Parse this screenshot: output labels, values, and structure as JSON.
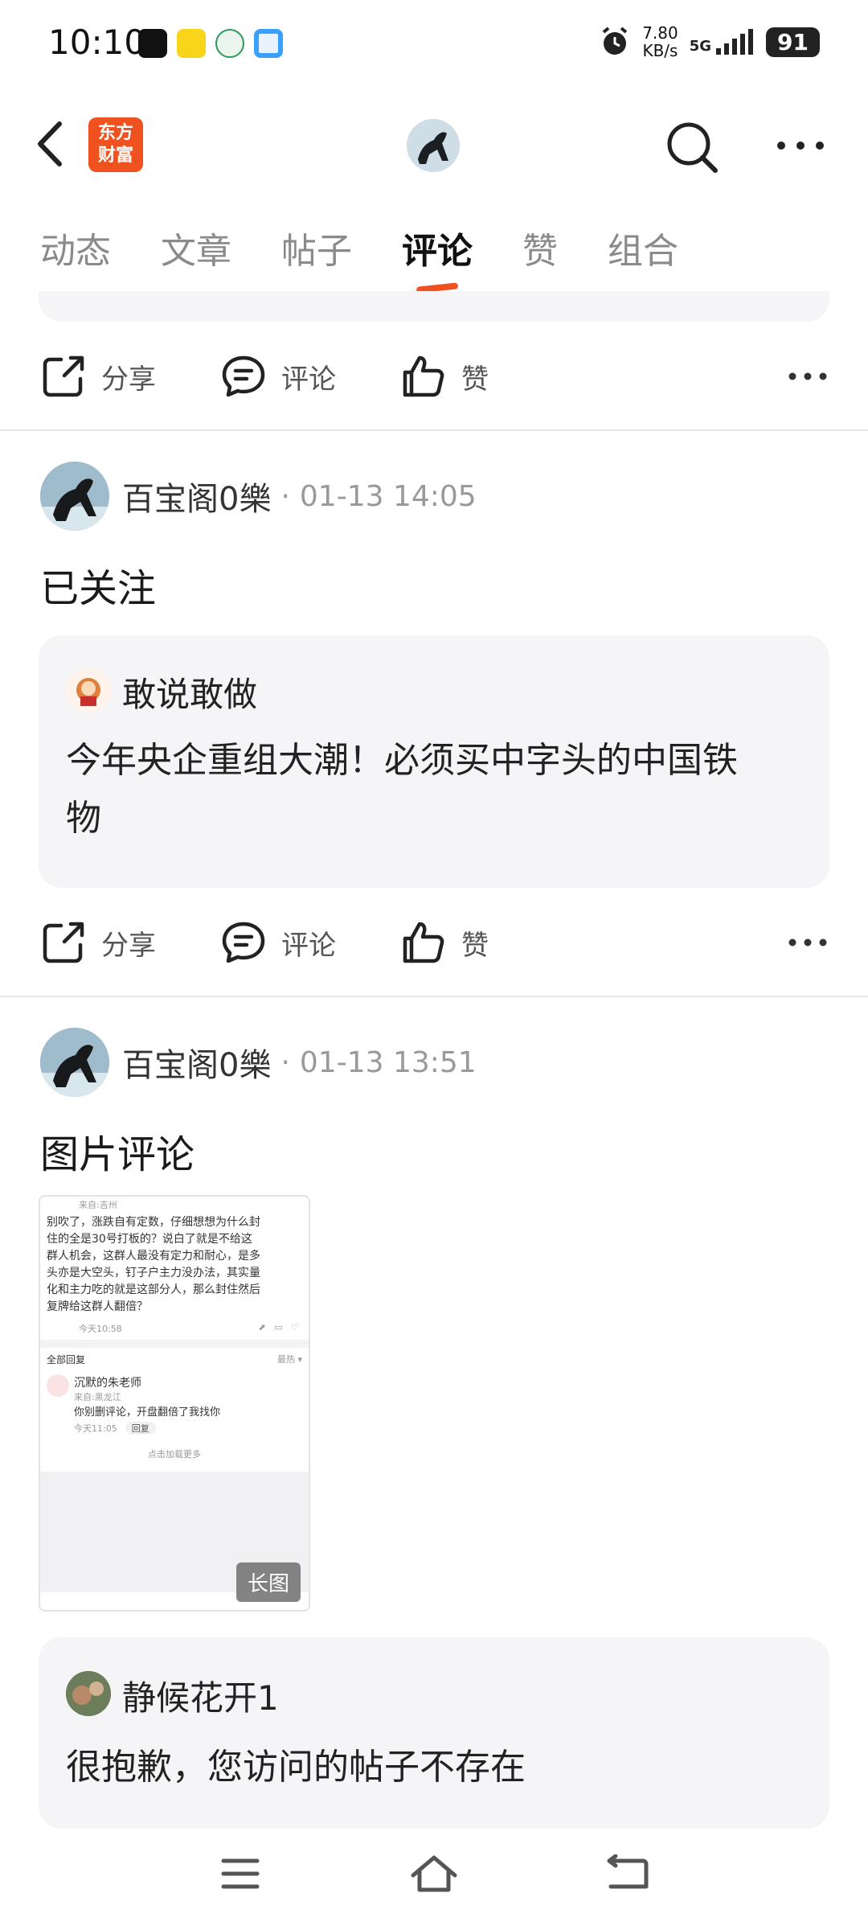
{
  "status": {
    "time": "10:10",
    "speed_value": "7.80",
    "speed_unit": "KB/s",
    "network": "5G",
    "battery": "91"
  },
  "header": {
    "logo_line1": "东方",
    "logo_line2": "财富"
  },
  "tabs": [
    {
      "label": "动态"
    },
    {
      "label": "文章"
    },
    {
      "label": "帖子"
    },
    {
      "label": "评论",
      "active": true
    },
    {
      "label": "赞"
    },
    {
      "label": "组合"
    }
  ],
  "actions": {
    "share": "分享",
    "comment": "评论",
    "like": "赞"
  },
  "posts": [
    {
      "author": "百宝阁0樂",
      "time": "01-13 14:05",
      "text": "已关注",
      "quote": {
        "author": "敢说敢做",
        "text_line1": "今年央企重组大潮！必须买中字头的中国铁",
        "text_line2": "物"
      }
    },
    {
      "author": "百宝阁0樂",
      "time": "01-13 13:51",
      "text": "图片评论",
      "image": {
        "line0": "来自:吉州",
        "lines": [
          "别吹了，涨跌自有定数，仔细想想为什么封",
          "住的全是30号打板的？说白了就是不给这",
          "群人机会，这群人最没有定力和耐心，是多",
          "头亦是大空头，钉子户主力没办法，其实量",
          "化和主力吃的就是这部分人，那么封住然后",
          "复牌给这群人翻倍？"
        ],
        "meta_time": "今天10:58",
        "all_replies": "全部回复",
        "sort": "最热 ▾",
        "reply_author": "沉默的朱老师",
        "reply_from": "来自:黑龙江",
        "reply_text": "你别删评论，开盘翻倍了我找你",
        "reply_time": "今天11:05",
        "reply_chip": "回复",
        "load_more": "点击加载更多",
        "badge": "长图"
      },
      "quote": {
        "author": "静候花开1",
        "text_line1": "很抱歉，您访问的帖子不存在"
      }
    }
  ],
  "colors": {
    "accent": "#f0521f",
    "card_bg": "#f5f5f7"
  }
}
